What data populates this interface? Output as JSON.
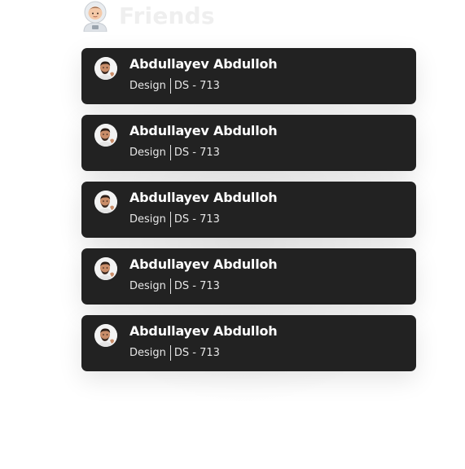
{
  "header": {
    "title": "Friends",
    "icon": "astronaut-emoji-icon"
  },
  "friends": [
    {
      "name": "Abdullayev Abdulloh",
      "department": "Design",
      "group": "DS - 713",
      "avatar": "memoji-avatar-icon"
    },
    {
      "name": "Abdullayev Abdulloh",
      "department": "Design",
      "group": "DS - 713",
      "avatar": "memoji-avatar-icon"
    },
    {
      "name": "Abdullayev Abdulloh",
      "department": "Design",
      "group": "DS - 713",
      "avatar": "memoji-avatar-icon"
    },
    {
      "name": "Abdullayev Abdulloh",
      "department": "Design",
      "group": "DS - 713",
      "avatar": "memoji-avatar-icon"
    },
    {
      "name": "Abdullayev Abdulloh",
      "department": "Design",
      "group": "DS - 713",
      "avatar": "memoji-avatar-icon"
    }
  ],
  "colors": {
    "card_bg": "#222222",
    "title": "#efefef",
    "name": "#ffffff",
    "meta": "#e6e6e6"
  }
}
